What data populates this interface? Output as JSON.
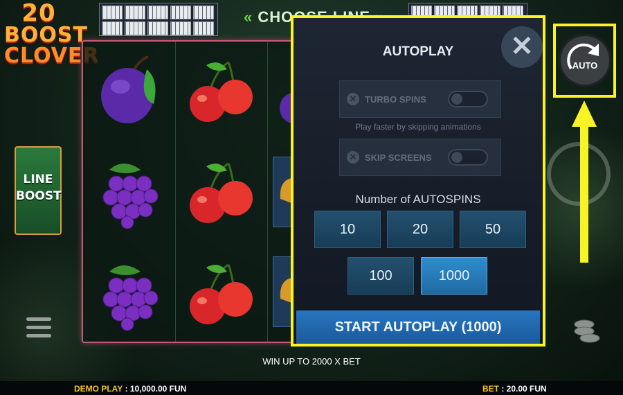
{
  "logo": {
    "line1": "20",
    "line2": "BOOST",
    "line3": "CLOVER"
  },
  "header": {
    "choose_line": "CHOOSE LINE"
  },
  "line_boost": {
    "line1": "LINE",
    "line2": "BOOST"
  },
  "reels": {
    "symbols": [
      [
        "plum",
        "cherries",
        "plum"
      ],
      [
        "grapes",
        "cherries",
        "bell"
      ],
      [
        "grapes",
        "cherries",
        "bell"
      ]
    ]
  },
  "auto_button": {
    "label": "AUTO"
  },
  "autoplay": {
    "title": "AUTOPLAY",
    "close_label": "✕",
    "turbo_spins": {
      "label": "TURBO SPINS",
      "enabled": false
    },
    "turbo_hint": "Play faster by skipping animations",
    "skip_screens": {
      "label": "SKIP SCREENS",
      "enabled": false
    },
    "count_label": "Number of AUTOSPINS",
    "options": [
      "10",
      "20",
      "50",
      "100",
      "1000"
    ],
    "selected": "1000",
    "start_label": "START AUTOPLAY (1000)"
  },
  "footer": {
    "win_text": "WIN UP TO 2000 X BET",
    "demo_label": "DEMO PLAY",
    "demo_value": ": 10,000.00 FUN",
    "bet_label": "BET",
    "bet_value": ": 20.00 FUN"
  },
  "colors": {
    "highlight": "#f7f325",
    "button": "#1f6aa3",
    "modal_bg": "#1a212c"
  }
}
